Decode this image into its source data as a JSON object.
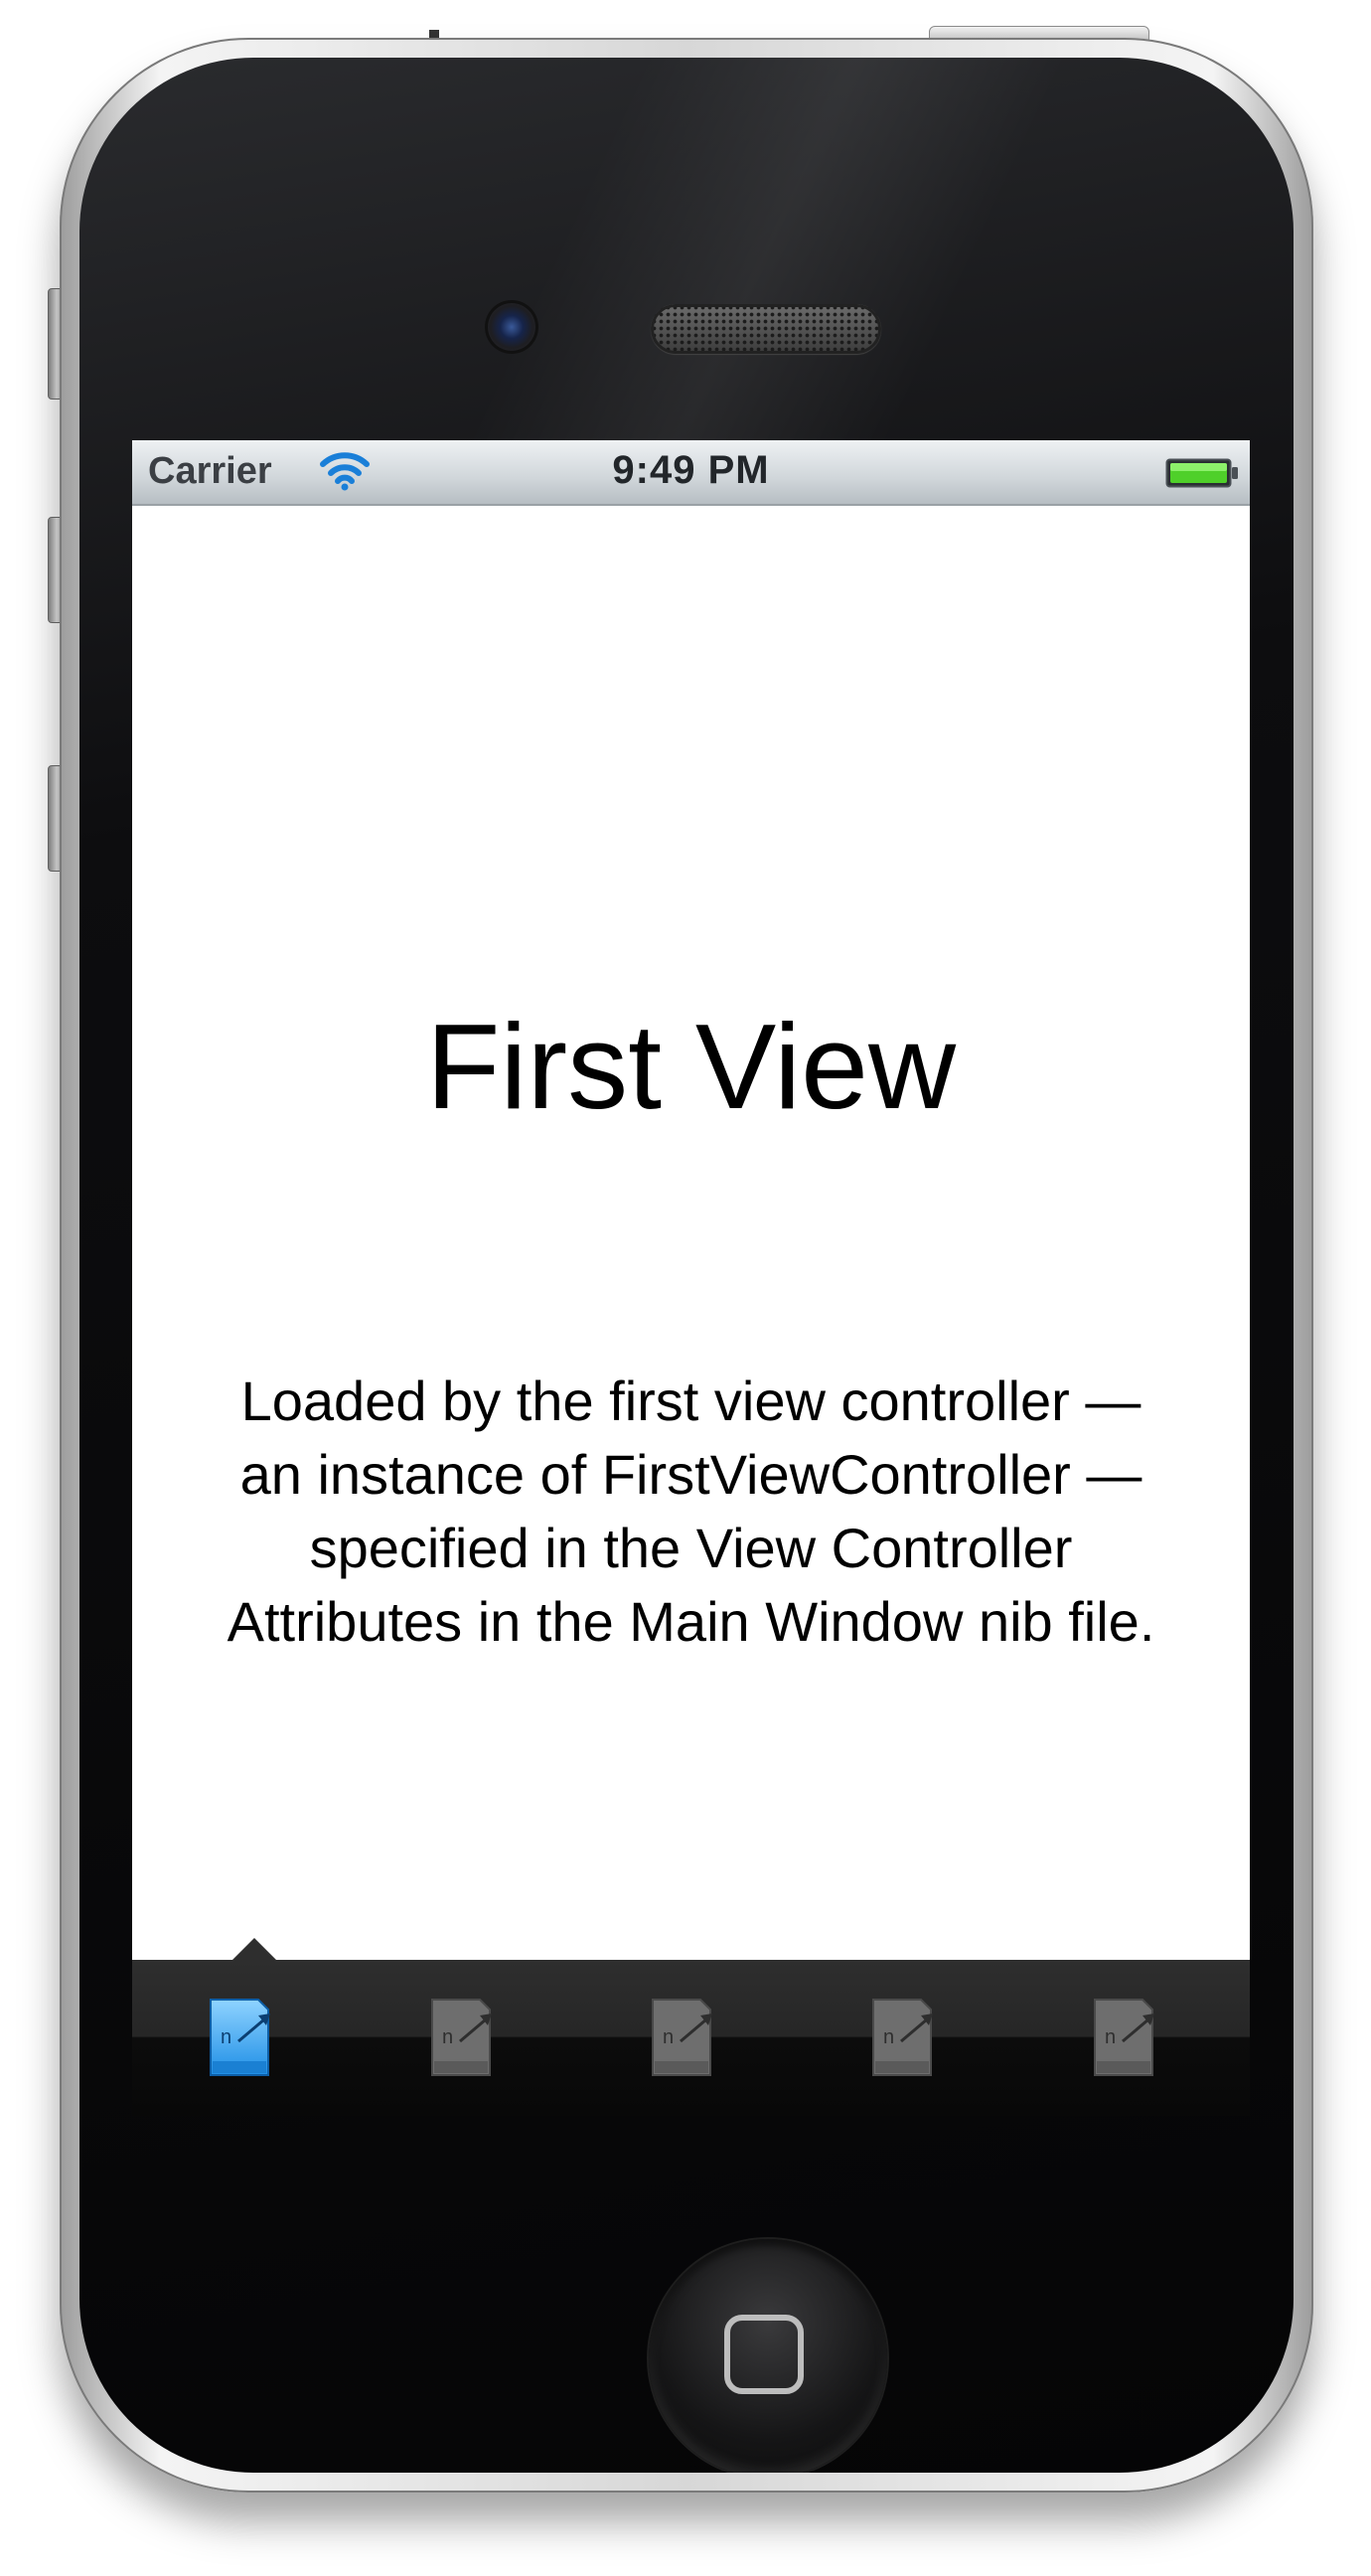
{
  "status_bar": {
    "carrier": "Carrier",
    "time": "9:49 PM",
    "wifi_icon": "wifi-icon",
    "battery_icon": "battery-full-icon",
    "battery_color": "#4fd02a"
  },
  "main": {
    "title": "First View",
    "description": "Loaded by the first view controller — an instance of FirstViewController — specified in the View Controller Attributes in the Main Window nib file."
  },
  "tab_bar": {
    "selected_index": 0,
    "items": [
      {
        "icon": "nib-file-icon",
        "selected": true
      },
      {
        "icon": "nib-file-icon",
        "selected": false
      },
      {
        "icon": "nib-file-icon",
        "selected": false
      },
      {
        "icon": "nib-file-icon",
        "selected": false
      },
      {
        "icon": "nib-file-icon",
        "selected": false
      }
    ],
    "selected_color": "#3aa4ea",
    "unselected_color": "#6e6e6e"
  },
  "hardware": {
    "home_button_icon": "home-square-icon"
  }
}
